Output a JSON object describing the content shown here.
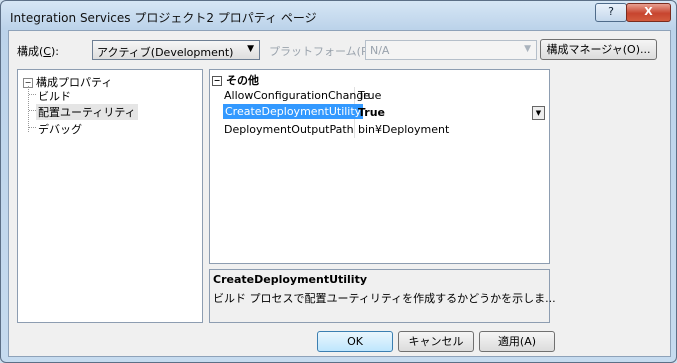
{
  "window": {
    "title": "Integration Services プロジェクト2 プロパティ ページ",
    "help_label": "?",
    "close_label": "X"
  },
  "toolbar": {
    "config_label_prefix": "構成(",
    "config_label_key": "C",
    "config_label_suffix": "):",
    "config_value": "アクティブ(Development)",
    "platform_label": "プラットフォーム(P):",
    "platform_value": "N/A",
    "config_manager_label": "構成マネージャ(O)..."
  },
  "tree": {
    "root": "構成プロパティ",
    "items": [
      "ビルド",
      "配置ユーティリティ",
      "デバッグ"
    ],
    "selected": "配置ユーティリティ"
  },
  "properties": {
    "category": "その他",
    "rows": [
      {
        "name": "AllowConfigurationChange",
        "value": "True"
      },
      {
        "name": "CreateDeploymentUtility",
        "value": "True"
      },
      {
        "name": "DeploymentOutputPath",
        "value": "bin¥Deployment"
      }
    ],
    "selected": "CreateDeploymentUtility"
  },
  "description": {
    "title": "CreateDeploymentUtility",
    "text": "ビルド プロセスで配置ユーティリティを作成するかどうかを示しま..."
  },
  "buttons": {
    "ok": "OK",
    "cancel": "キャンセル",
    "apply": "適用(A)"
  },
  "colors": {
    "selection": "#3399ff",
    "accent_border": "#3c7fb1"
  }
}
